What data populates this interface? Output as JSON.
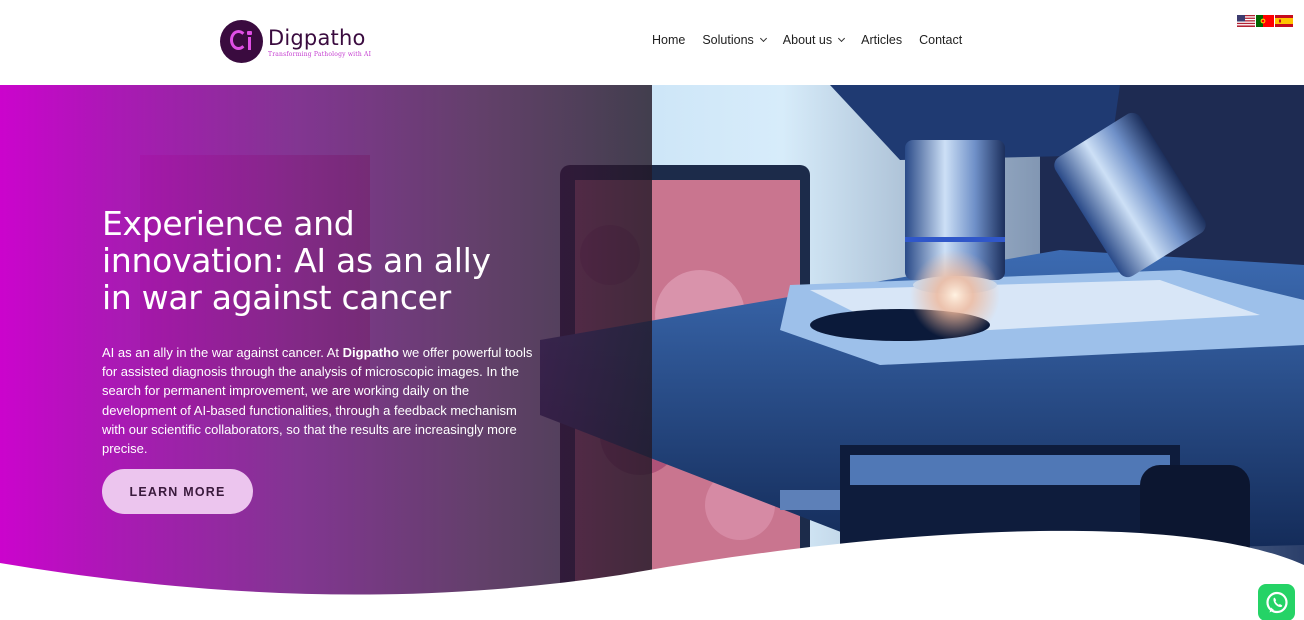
{
  "brand": {
    "name": "Digpatho",
    "tagline": "Transforming Pathology with AI",
    "colors": {
      "primary": "#cc00cc",
      "dark": "#3a0b3f",
      "button": "#ecc5ee",
      "whatsapp": "#25d366"
    }
  },
  "nav": {
    "items": [
      {
        "label": "Home",
        "has_dropdown": false
      },
      {
        "label": "Solutions",
        "has_dropdown": true
      },
      {
        "label": "About us",
        "has_dropdown": true
      },
      {
        "label": "Articles",
        "has_dropdown": false
      },
      {
        "label": "Contact",
        "has_dropdown": false
      }
    ]
  },
  "languages": [
    {
      "icon": "us-flag-icon",
      "code": "en"
    },
    {
      "icon": "portugal-flag-icon",
      "code": "pt"
    },
    {
      "icon": "spain-flag-icon",
      "code": "es"
    }
  ],
  "hero": {
    "title_lines": [
      "Experience and",
      "innovation: AI as an ally",
      "in war against cancer"
    ],
    "body_prefix": "AI as an ally in the war against cancer. At ",
    "body_brand": "Digpatho",
    "body_suffix": " we offer powerful tools for assisted diagnosis through the analysis of microscopic images. In the search for permanent improvement, we are working daily on the development of AI-based functionalities, through a feedback mechanism with our scientific collaborators, so that the results are increasingly more precise.",
    "cta_label": "LEARN MORE",
    "background_image": "microscope-photo"
  },
  "floating": {
    "icon": "whatsapp-icon"
  }
}
